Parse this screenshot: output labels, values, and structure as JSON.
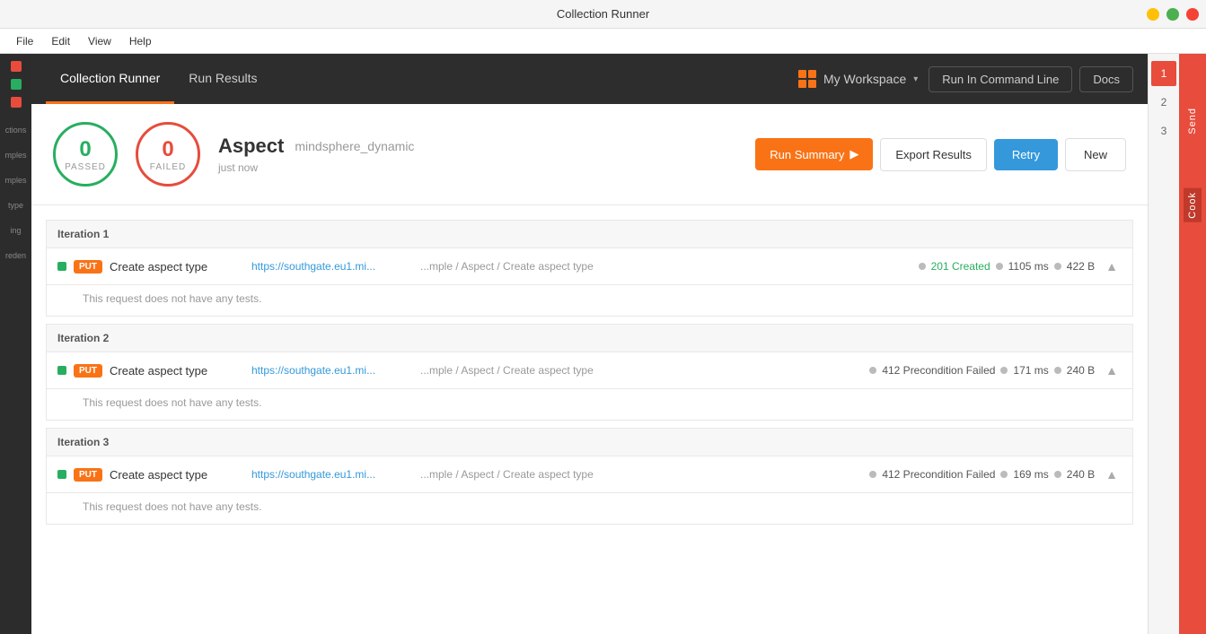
{
  "window": {
    "title": "Collection Runner",
    "controls": {
      "minimize": "−",
      "maximize": "□",
      "close": "×"
    }
  },
  "menu": {
    "items": [
      "File",
      "Edit",
      "View",
      "Help"
    ]
  },
  "topNav": {
    "tabs": [
      {
        "label": "Collection Runner",
        "active": true
      },
      {
        "label": "Run Results",
        "active": false
      }
    ],
    "workspace": {
      "label": "My Workspace",
      "arrow": "▾"
    },
    "runCmdLine": "Run In Command Line",
    "docs": "Docs"
  },
  "summary": {
    "passed": {
      "count": "0",
      "label": "PASSED"
    },
    "failed": {
      "count": "0",
      "label": "FAILED"
    },
    "title": "Aspect",
    "collection": "mindsphere_dynamic",
    "time": "just now",
    "buttons": {
      "runSummary": "Run Summary",
      "exportResults": "Export Results",
      "retry": "Retry",
      "new": "New"
    }
  },
  "iterations": [
    {
      "header": "Iteration 1",
      "requests": [
        {
          "method": "PUT",
          "name": "Create aspect type",
          "url": "https://southgate.eu1.mi...",
          "path": "...mple / Aspect / Create aspect type",
          "statusCode": "201",
          "statusText": "201 Created",
          "time": "1105 ms",
          "size": "422 B",
          "noTests": "This request does not have any tests."
        }
      ]
    },
    {
      "header": "Iteration 2",
      "requests": [
        {
          "method": "PUT",
          "name": "Create aspect type",
          "url": "https://southgate.eu1.mi...",
          "path": "...mple / Aspect / Create aspect type",
          "statusCode": "412",
          "statusText": "412 Precondition Failed",
          "time": "171 ms",
          "size": "240 B",
          "noTests": "This request does not have any tests."
        }
      ]
    },
    {
      "header": "Iteration 3",
      "requests": [
        {
          "method": "PUT",
          "name": "Create aspect type",
          "url": "https://southgate.eu1.mi...",
          "path": "...mple / Aspect / Create aspect type",
          "statusCode": "412",
          "statusText": "412 Precondition Failed",
          "time": "169 ms",
          "size": "240 B",
          "noTests": "This request does not have any tests."
        }
      ]
    }
  ],
  "rightPanel": {
    "iterations": [
      "1",
      "2",
      "3"
    ]
  },
  "sidebarDots": [
    {
      "color": "#e74c3c"
    },
    {
      "color": "#27ae60"
    },
    {
      "color": "#e74c3c"
    }
  ],
  "sidebarLabels": [
    "ctions",
    "mples",
    "mples",
    "type",
    "ing",
    "reden"
  ]
}
